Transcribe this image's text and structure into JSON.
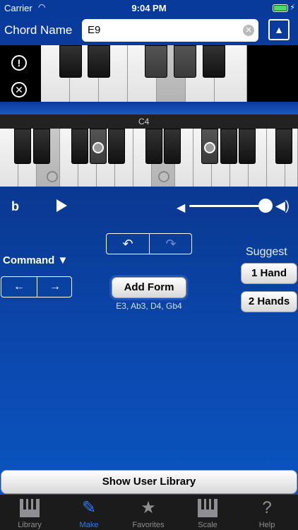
{
  "status": {
    "carrier": "Carrier",
    "time": "9:04 PM"
  },
  "header": {
    "label": "Chord Name",
    "chord_value": "E9",
    "clear_glyph": "✕",
    "up_glyph": "▲"
  },
  "side_icons": {
    "alert": "!",
    "close": "✕"
  },
  "keyboard": {
    "octave_label": "C4"
  },
  "transport": {
    "flat": "b"
  },
  "undo": {
    "undo_glyph": "↶",
    "redo_glyph": "↷"
  },
  "command": {
    "label": "Command ▼",
    "left_glyph": "←",
    "right_glyph": "→"
  },
  "add_form": {
    "label": "Add Form",
    "notes": "E3, Ab3, D4, Gb4"
  },
  "suggest": {
    "label": "Suggest",
    "one_hand": "1 Hand",
    "two_hands": "2 Hands"
  },
  "library_button": "Show User Library",
  "tabs": [
    {
      "label": "Library",
      "icon": "library-icon"
    },
    {
      "label": "Make",
      "icon": "pencil-icon"
    },
    {
      "label": "Favorites",
      "icon": "star-icon"
    },
    {
      "label": "Scale",
      "icon": "scale-icon"
    },
    {
      "label": "Help",
      "icon": "question-icon"
    }
  ],
  "colors": {
    "accent": "#2f7cf6",
    "background": "#0a3a95"
  }
}
